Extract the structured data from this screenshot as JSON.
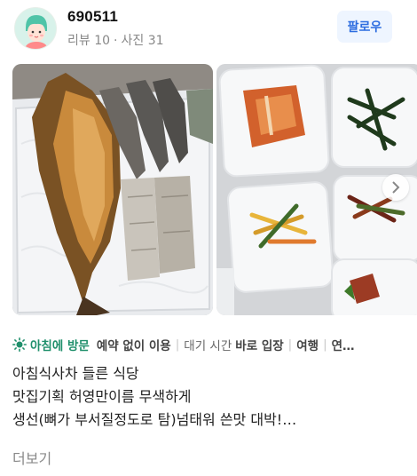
{
  "profile": {
    "username": "690511",
    "stats": {
      "reviews": "리뷰 10",
      "separator": "·",
      "photos": "사진 31"
    },
    "follow_label": "팔로우",
    "avatar_icon": "person-avatar-icon"
  },
  "photos": [
    {
      "alt": "grilled-fish-platter"
    },
    {
      "alt": "side-dishes"
    }
  ],
  "tags": {
    "visit": "아침에 방문",
    "reservation": "예약 없이 이용",
    "wait_label": "대기 시간",
    "wait_value": "바로 입장",
    "purpose": "여행",
    "more": "연…"
  },
  "review": {
    "lines": [
      "아침식사차 들른 식당",
      "맛집기획 허영만이름 무색하게",
      "생선(뼈가 부서질정도로 탐)넘태워 쓴맛 대박!…"
    ],
    "more_label": "더보기"
  },
  "colors": {
    "accent_green": "#1f8f6b",
    "follow_blue": "#2d6de0",
    "follow_bg": "#eef5ff"
  }
}
